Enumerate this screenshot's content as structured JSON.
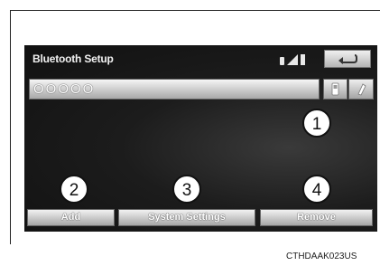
{
  "screen": {
    "title": "Bluetooth Setup",
    "device_name": "OOOOO",
    "buttons": {
      "add": "Add",
      "system_settings": "System Settings",
      "remove": "Remove"
    },
    "icons": {
      "back": "back-arrow-icon",
      "phone": "phone-icon",
      "audio": "audio-player-icon",
      "signal": "signal-strength-icon",
      "battery": "battery-icon",
      "bluetooth_device": "bluetooth-device-icon"
    }
  },
  "callouts": [
    "1",
    "2",
    "3",
    "4"
  ],
  "caption": "CTHDAAK023US"
}
